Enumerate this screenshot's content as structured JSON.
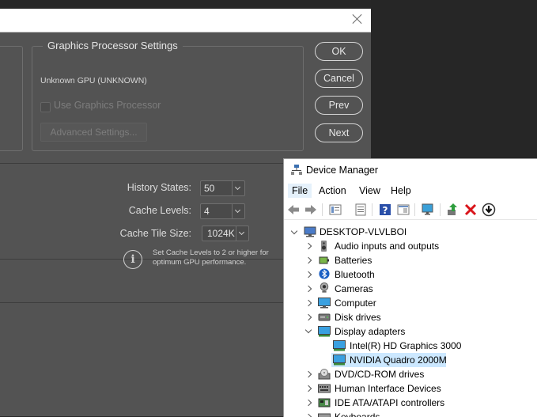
{
  "photoshop": {
    "gpu_group_title": "Graphics Processor Settings",
    "gpu_name": "Unknown GPU (UNKNOWN)",
    "use_gpu_label": "Use Graphics Processor",
    "advanced_label": "Advanced Settings...",
    "buttons": {
      "ok": "OK",
      "cancel": "Cancel",
      "prev": "Prev",
      "next": "Next"
    },
    "history_states_label": "History States:",
    "history_states_value": "50",
    "cache_levels_label": "Cache Levels:",
    "cache_levels_value": "4",
    "cache_tile_label": "Cache Tile Size:",
    "cache_tile_value": "1024K",
    "info_text": "Set Cache Levels to 2 or higher for optimum GPU performance."
  },
  "device_manager": {
    "title": "Device Manager",
    "menu": [
      "File",
      "Action",
      "View",
      "Help"
    ],
    "root": "DESKTOP-VLVLBOI",
    "items": [
      {
        "label": "Audio inputs and outputs",
        "icon": "speaker-icon"
      },
      {
        "label": "Batteries",
        "icon": "battery-icon"
      },
      {
        "label": "Bluetooth",
        "icon": "bluetooth-icon"
      },
      {
        "label": "Cameras",
        "icon": "camera-icon"
      },
      {
        "label": "Computer",
        "icon": "monitor-icon"
      },
      {
        "label": "Disk drives",
        "icon": "disk-icon"
      },
      {
        "label": "Display adapters",
        "icon": "display-adapter-icon"
      },
      {
        "label": "Intel(R) HD Graphics 3000",
        "icon": "display-adapter-icon"
      },
      {
        "label": "NVIDIA Quadro 2000M",
        "icon": "display-adapter-icon"
      },
      {
        "label": "DVD/CD-ROM drives",
        "icon": "dvd-icon"
      },
      {
        "label": "Human Interface Devices",
        "icon": "hid-icon"
      },
      {
        "label": "IDE ATA/ATAPI controllers",
        "icon": "ide-icon"
      },
      {
        "label": "Keyboards",
        "icon": "keyboard-icon"
      }
    ]
  }
}
